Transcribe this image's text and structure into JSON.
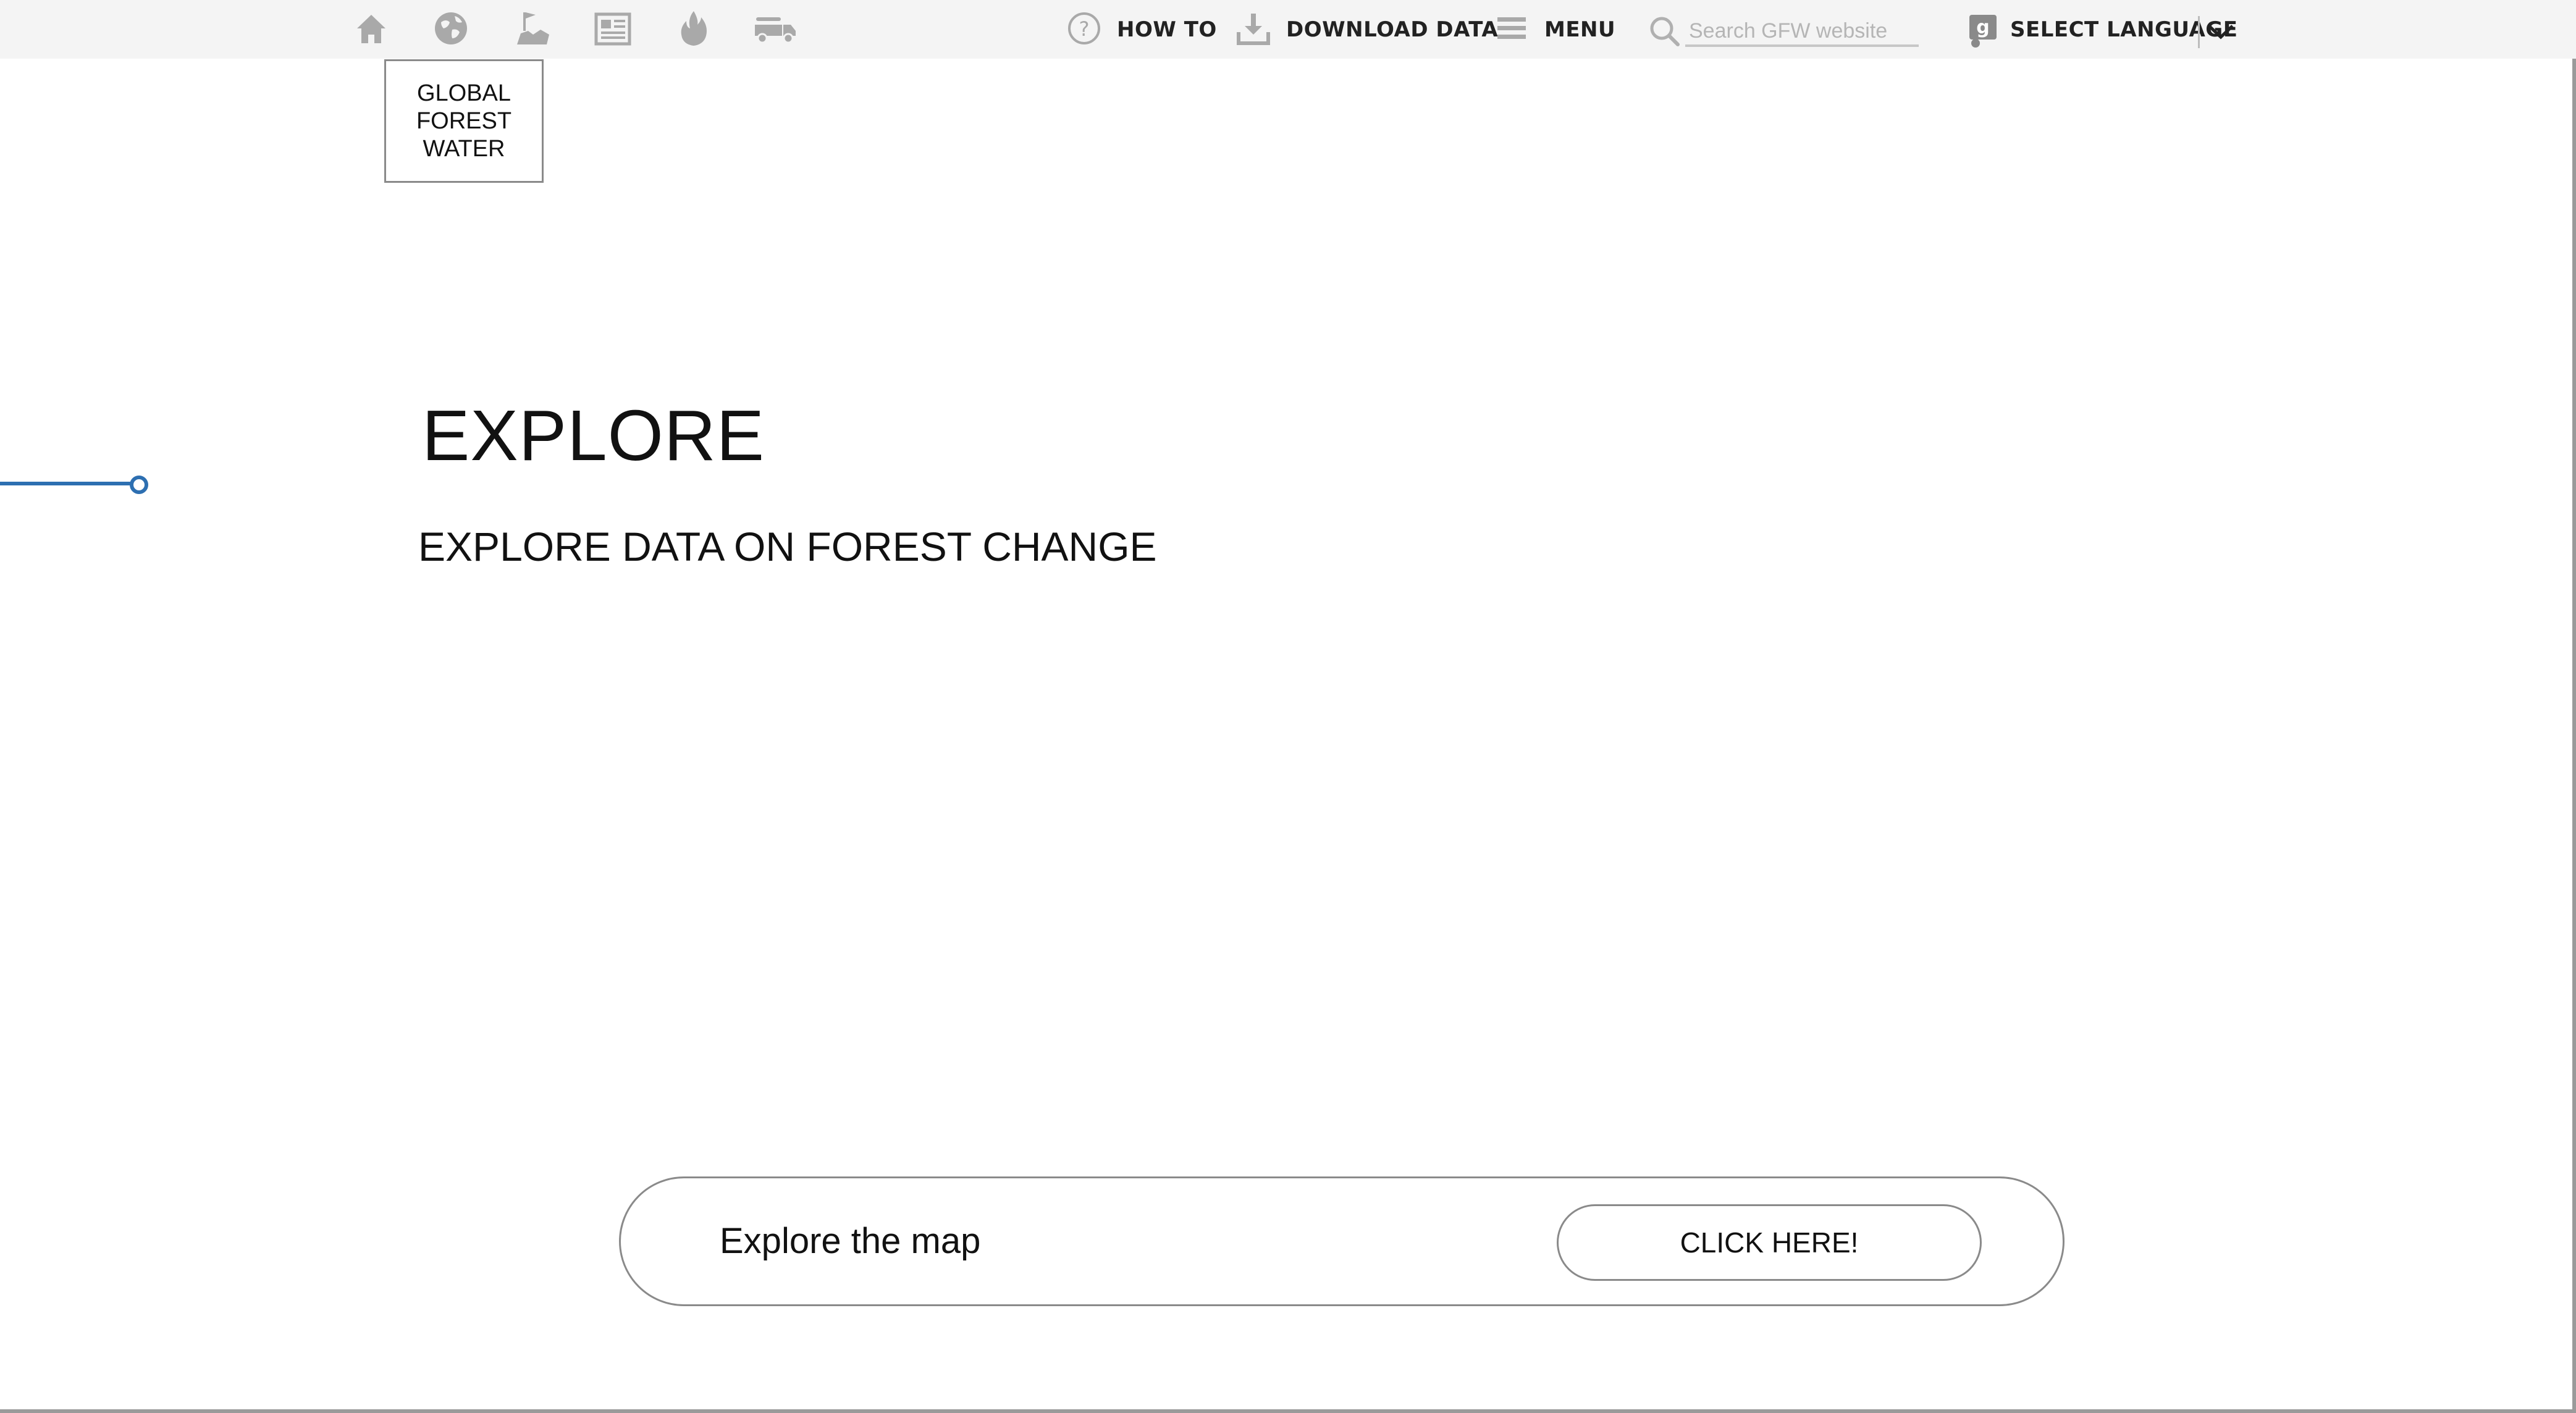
{
  "topbar": {
    "icons": [
      {
        "name": "home-icon"
      },
      {
        "name": "globe-icon"
      },
      {
        "name": "countries-icon"
      },
      {
        "name": "news-icon"
      },
      {
        "name": "fire-icon"
      },
      {
        "name": "commodities-icon"
      }
    ],
    "how_to_label": "HOW TO",
    "download_label": "DOWNLOAD DATA",
    "menu_label": "MENU",
    "search_placeholder": "Search GFW website",
    "language_label": "SELECT LANGUAGE"
  },
  "logo": {
    "line1": "GLOBAL",
    "line2": "FOREST",
    "line3": "WATER"
  },
  "hero": {
    "title": "EXPLORE",
    "subtitle": "EXPLORE DATA ON FOREST CHANGE"
  },
  "slider": {
    "accent_color": "#2d6fb1"
  },
  "cta": {
    "label": "Explore the map",
    "button_label": "CLICK HERE!"
  }
}
